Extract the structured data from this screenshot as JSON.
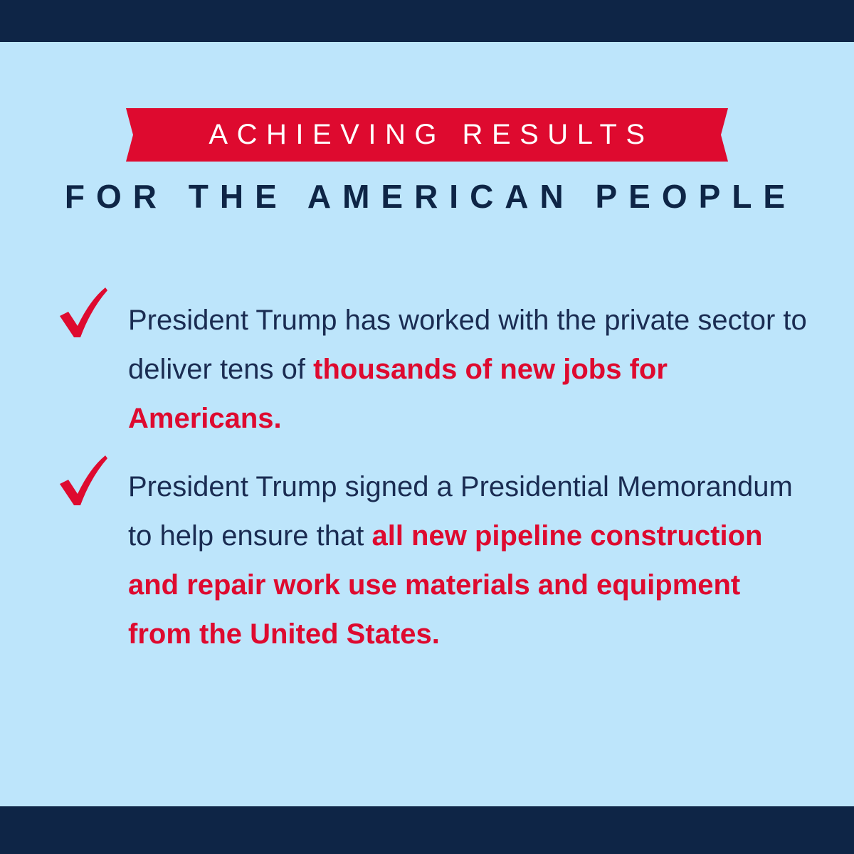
{
  "header": {
    "ribbon_text": "ACHIEVING RESULTS",
    "subtitle": "FOR THE AMERICAN PEOPLE"
  },
  "items": [
    {
      "icon": "check-icon",
      "plain": "President Trump has worked with the private sector to deliver tens of ",
      "highlight": "thousands of new jobs for Americans."
    },
    {
      "icon": "check-icon",
      "plain": "President Trump signed a Presidential Memorandum to help ensure that ",
      "highlight": "all new pipeline construction and repair work use materials and equipment from the United States."
    }
  ],
  "colors": {
    "background": "#bde5fb",
    "navy": "#0e2546",
    "red": "#de0a2f",
    "body_text": "#1a2c52"
  }
}
